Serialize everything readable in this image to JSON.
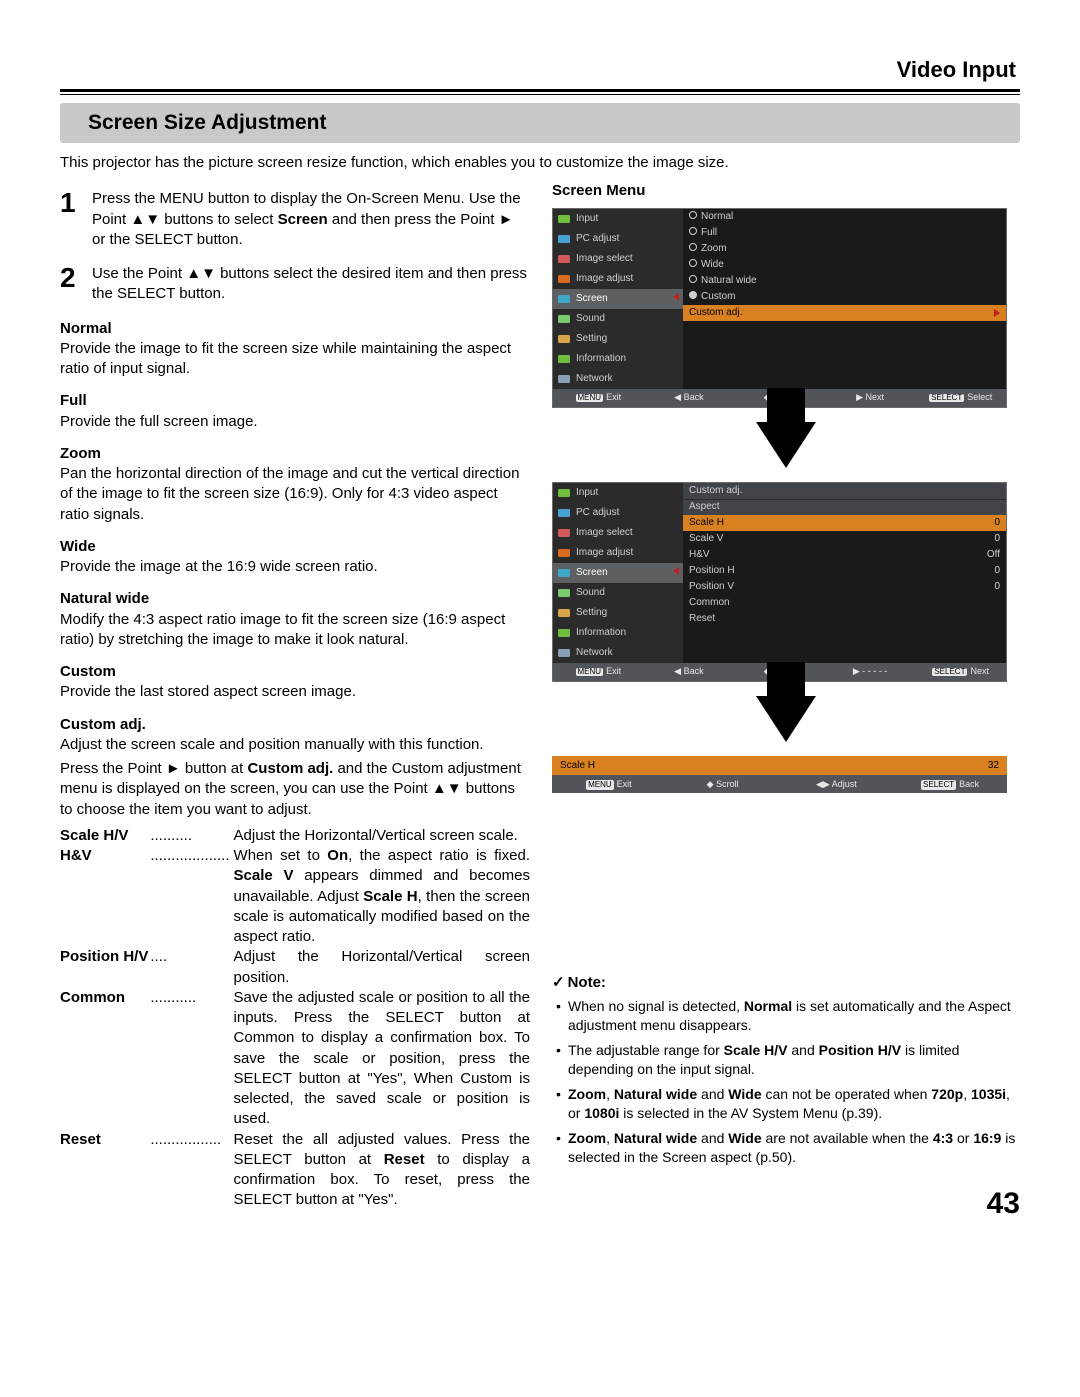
{
  "header": {
    "section": "Video Input",
    "title": "Screen Size Adjustment",
    "page_number": "43"
  },
  "intro": "This projector has the picture screen resize function, which enables you to customize the image size.",
  "steps": [
    {
      "num": "1",
      "text_pre": "Press the MENU button to display the On-Screen Menu. Use the Point ▲▼ buttons to select ",
      "bold": "Screen",
      "text_post": " and then press the Point ► or the SELECT button."
    },
    {
      "num": "2",
      "text_pre": "Use the Point ▲▼ buttons select the desired item and then press the SELECT button.",
      "bold": "",
      "text_post": ""
    }
  ],
  "modes": {
    "normal": {
      "title": "Normal",
      "body": "Provide the image to fit the screen size while maintaining the aspect ratio of input signal."
    },
    "full": {
      "title": "Full",
      "body": "Provide the full screen image."
    },
    "zoom": {
      "title": "Zoom",
      "body": "Pan the horizontal direction of the image and cut the vertical direction of the image to fit the screen size (16:9). Only for 4:3 video aspect ratio signals."
    },
    "wide": {
      "title": "Wide",
      "body": "Provide the image at the 16:9 wide screen ratio."
    },
    "natural": {
      "title": "Natural wide",
      "body": "Modify the 4:3 aspect ratio image to fit the screen size (16:9 aspect ratio) by stretching the image to make it look natural."
    },
    "custom": {
      "title": "Custom",
      "body": "Provide the last stored aspect screen image."
    },
    "custom_adj": {
      "title": "Custom adj.",
      "p1": "Adjust the screen scale and position manually with this function.",
      "p2_pre": "Press the Point ► button at ",
      "p2_bold": "Custom adj.",
      "p2_post": " and the Custom adjustment menu is displayed on the screen, you can use the Point ▲▼ buttons to choose the item you want to adjust."
    }
  },
  "adjust": [
    {
      "key": "Scale H/V",
      "dots": "..........",
      "val": "Adjust the Horizontal/Vertical screen scale."
    },
    {
      "key": "H&V",
      "dots": "...................",
      "val_pre": "When set to ",
      "b1": "On",
      "val_mid": ", the aspect ratio is fixed. ",
      "b2": "Scale V",
      "val_mid2": " appears dimmed and becomes unavailable. Adjust ",
      "b3": "Scale H",
      "val_post": ", then the screen scale is automatically modified based on the aspect ratio."
    },
    {
      "key": "Position H/V",
      "dots": "....",
      "val": "Adjust the Horizontal/Vertical screen position."
    },
    {
      "key": "Common",
      "dots": "...........",
      "val": "Save the adjusted scale or position to all the inputs. Press the SELECT button at Common to display a confirmation box. To save the scale or position, press the SELECT button at \"Yes\", When Custom is selected, the saved scale or position is used."
    },
    {
      "key": "Reset",
      "dots": ".................",
      "val_pre": "Reset the all adjusted values. Press the SELECT button at ",
      "b1": "Reset",
      "val_post": " to display a confirmation box. To reset, press the SELECT button at \"Yes\"."
    }
  ],
  "right": {
    "label": "Screen Menu",
    "osd1": {
      "side": [
        "Input",
        "PC adjust",
        "Image select",
        "Image adjust",
        "Screen",
        "Sound",
        "Setting",
        "Information",
        "Network"
      ],
      "opts": [
        "Normal",
        "Full",
        "Zoom",
        "Wide",
        "Natural wide",
        "Custom",
        "Custom adj."
      ],
      "foot": {
        "a": "Exit",
        "b": "◀ Back",
        "c": "◆ Move",
        "d": "▶ Next",
        "e": "Select",
        "pill_a": "MENU",
        "pill_e": "SELECT"
      }
    },
    "osd2": {
      "title1": "Custom adj.",
      "title2": "Aspect",
      "rows": [
        {
          "k": "Scale H",
          "v": "0",
          "sel": true
        },
        {
          "k": "Scale V",
          "v": "0"
        },
        {
          "k": "H&V",
          "v": "Off"
        },
        {
          "k": "Position H",
          "v": "0"
        },
        {
          "k": "Position V",
          "v": "0"
        },
        {
          "k": "Common",
          "v": ""
        },
        {
          "k": "Reset",
          "v": ""
        }
      ],
      "foot": {
        "a": "Exit",
        "b": "◀ Back",
        "c": "◆ Move",
        "d": "▶ - - - - -",
        "e": "Next",
        "pill_a": "MENU",
        "pill_e": "SELECT"
      }
    },
    "osd3": {
      "k": "Scale H",
      "v": "32",
      "foot": {
        "a": "Exit",
        "b": "◆ Scroll",
        "c": "◀▶ Adjust",
        "d": "Back",
        "pill_a": "MENU",
        "pill_d": "SELECT"
      }
    },
    "note": {
      "title": "Note:",
      "items": [
        {
          "pre": "When no signal is detected, ",
          "b1": "Normal",
          "post": " is set automatically and the Aspect adjustment menu disappears."
        },
        {
          "pre": "The adjustable range for ",
          "b1": "Scale H/V",
          "mid": " and ",
          "b2": "Position H/V",
          "post": " is limited depending on the input signal."
        },
        {
          "b1": "Zoom",
          "s1": ", ",
          "b2": "Natural wide",
          "s2": " and ",
          "b3": "Wide",
          "mid": " can not be operated when ",
          "b4": "720p",
          "s3": ", ",
          "b5": "1035i",
          "s4": ", or ",
          "b6": "1080i",
          "post": " is selected in the AV System Menu (p.39)."
        },
        {
          "b1": "Zoom",
          "s1": ", ",
          "b2": "Natural wide",
          "s2": " and ",
          "b3": "Wide",
          "mid": " are not available when the ",
          "b4": "4:3",
          "s3": " or ",
          "b5": "16:9",
          "post": " is selected in the Screen aspect (p.50)."
        }
      ]
    }
  }
}
